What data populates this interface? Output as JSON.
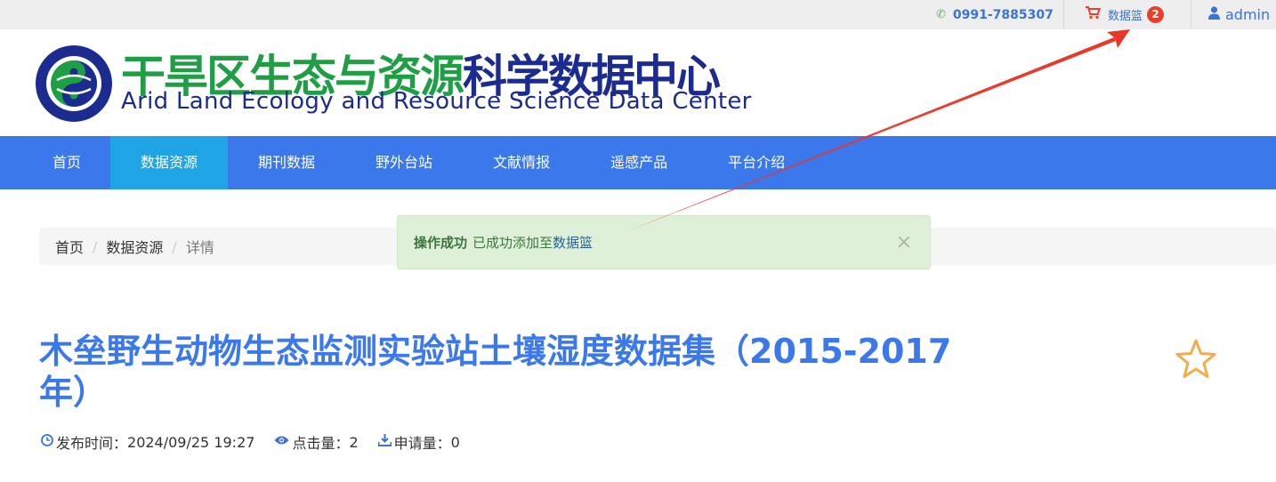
{
  "topbar": {
    "phone": "0991-7885307",
    "cart_label": "数据篮",
    "cart_count": "2",
    "user": "admin"
  },
  "header": {
    "title_cn_green": "干旱区生态与资源",
    "title_cn_blue": "科学数据中心",
    "title_en": "Arid Land Ecology and Resource Science Data Center"
  },
  "nav": {
    "items": [
      "首页",
      "数据资源",
      "期刊数据",
      "野外台站",
      "文献情报",
      "遥感产品",
      "平台介绍"
    ],
    "active": "数据资源"
  },
  "breadcrumb": [
    "首页",
    "数据资源",
    "详情"
  ],
  "alert": {
    "strong": "操作成功",
    "text": "已成功添加至",
    "link": "数据篮",
    "close": "×"
  },
  "dataset": {
    "title": "木垒野生动物生态监测实验站土壤湿度数据集（2015-2017年）",
    "publish_label": "发布时间：",
    "publish_time": "2024/09/25 19:27",
    "views_label": "点击量：",
    "views": "2",
    "requests_label": "申请量：",
    "requests": "0"
  },
  "colors": {
    "primary": "#3a78ec",
    "nav_active": "#1fa5e6",
    "green_title": "#1f9e46",
    "navy_title": "#1c2b8f",
    "alert_bg": "#dff0d8",
    "badge": "#e8412b",
    "star": "#f0ad4e"
  },
  "icons": [
    "phone-icon",
    "cart-icon",
    "user-icon",
    "clock-icon",
    "eye-icon",
    "download-icon",
    "star-icon",
    "close-icon"
  ]
}
